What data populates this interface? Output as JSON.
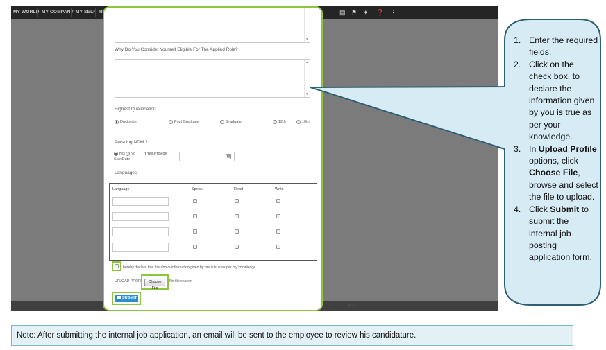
{
  "nav": {
    "items": [
      "MY WORLD",
      "MY COMPANY",
      "MY SELF"
    ],
    "partial_item": "R"
  },
  "topbar_icons": [
    "book-icon",
    "flag-icon",
    "pin-icon",
    "help-icon",
    "share-icon"
  ],
  "form": {
    "eligibility_label": "Why Do You Consider Yourself Eligible For The Applied Role?",
    "qualification": {
      "label": "Highest Qualification",
      "options": [
        "Doctorate",
        "Post Graduate",
        "Graduate",
        "12th",
        "10th"
      ],
      "selected": "Doctorate"
    },
    "ndm": {
      "label": "Persuing NDM ?",
      "yes": "Yes",
      "no": "No",
      "provide_label": "If Yes,Provide",
      "start_label": "StartDate",
      "selected": "Yes"
    },
    "languages": {
      "label": "Languages",
      "headers": [
        "Language",
        "Speak",
        "Read",
        "Write"
      ],
      "row_count": 4
    },
    "declaration": "hereby declare that the above information given by me is true as per my knowledge",
    "upload": {
      "label": "UPLOAD PROFILE",
      "button": "Choose File",
      "status": "No file chosen"
    },
    "submit_label": "SUBMIT"
  },
  "callout": {
    "steps": [
      {
        "num": "1.",
        "parts": [
          {
            "t": "Enter the required fields.",
            "b": false
          }
        ]
      },
      {
        "num": "2.",
        "parts": [
          {
            "t": "Click on the check box, to declare the information given by you is true as per your knowledge.",
            "b": false
          }
        ]
      },
      {
        "num": "3.",
        "parts": [
          {
            "t": "In ",
            "b": false
          },
          {
            "t": "Upload Profile",
            "b": true
          },
          {
            "t": " options, click ",
            "b": false
          },
          {
            "t": "Choose File",
            "b": true
          },
          {
            "t": ", browse and select the file to upload.",
            "b": false
          }
        ]
      },
      {
        "num": "4.",
        "parts": [
          {
            "t": "Click ",
            "b": false
          },
          {
            "t": "Submit",
            "b": true
          },
          {
            "t": " to submit the internal job posting application form.",
            "b": false
          }
        ]
      }
    ]
  },
  "note": "Note: After submitting the internal job application, an email will be sent to the employee to review his candidature.",
  "colors": {
    "highlight": "#8cc63f",
    "callout_fill": "#d6ebf3",
    "callout_stroke": "#2f5f72",
    "submit": "#2a8fd0",
    "note_fill": "#e3f1f5"
  }
}
